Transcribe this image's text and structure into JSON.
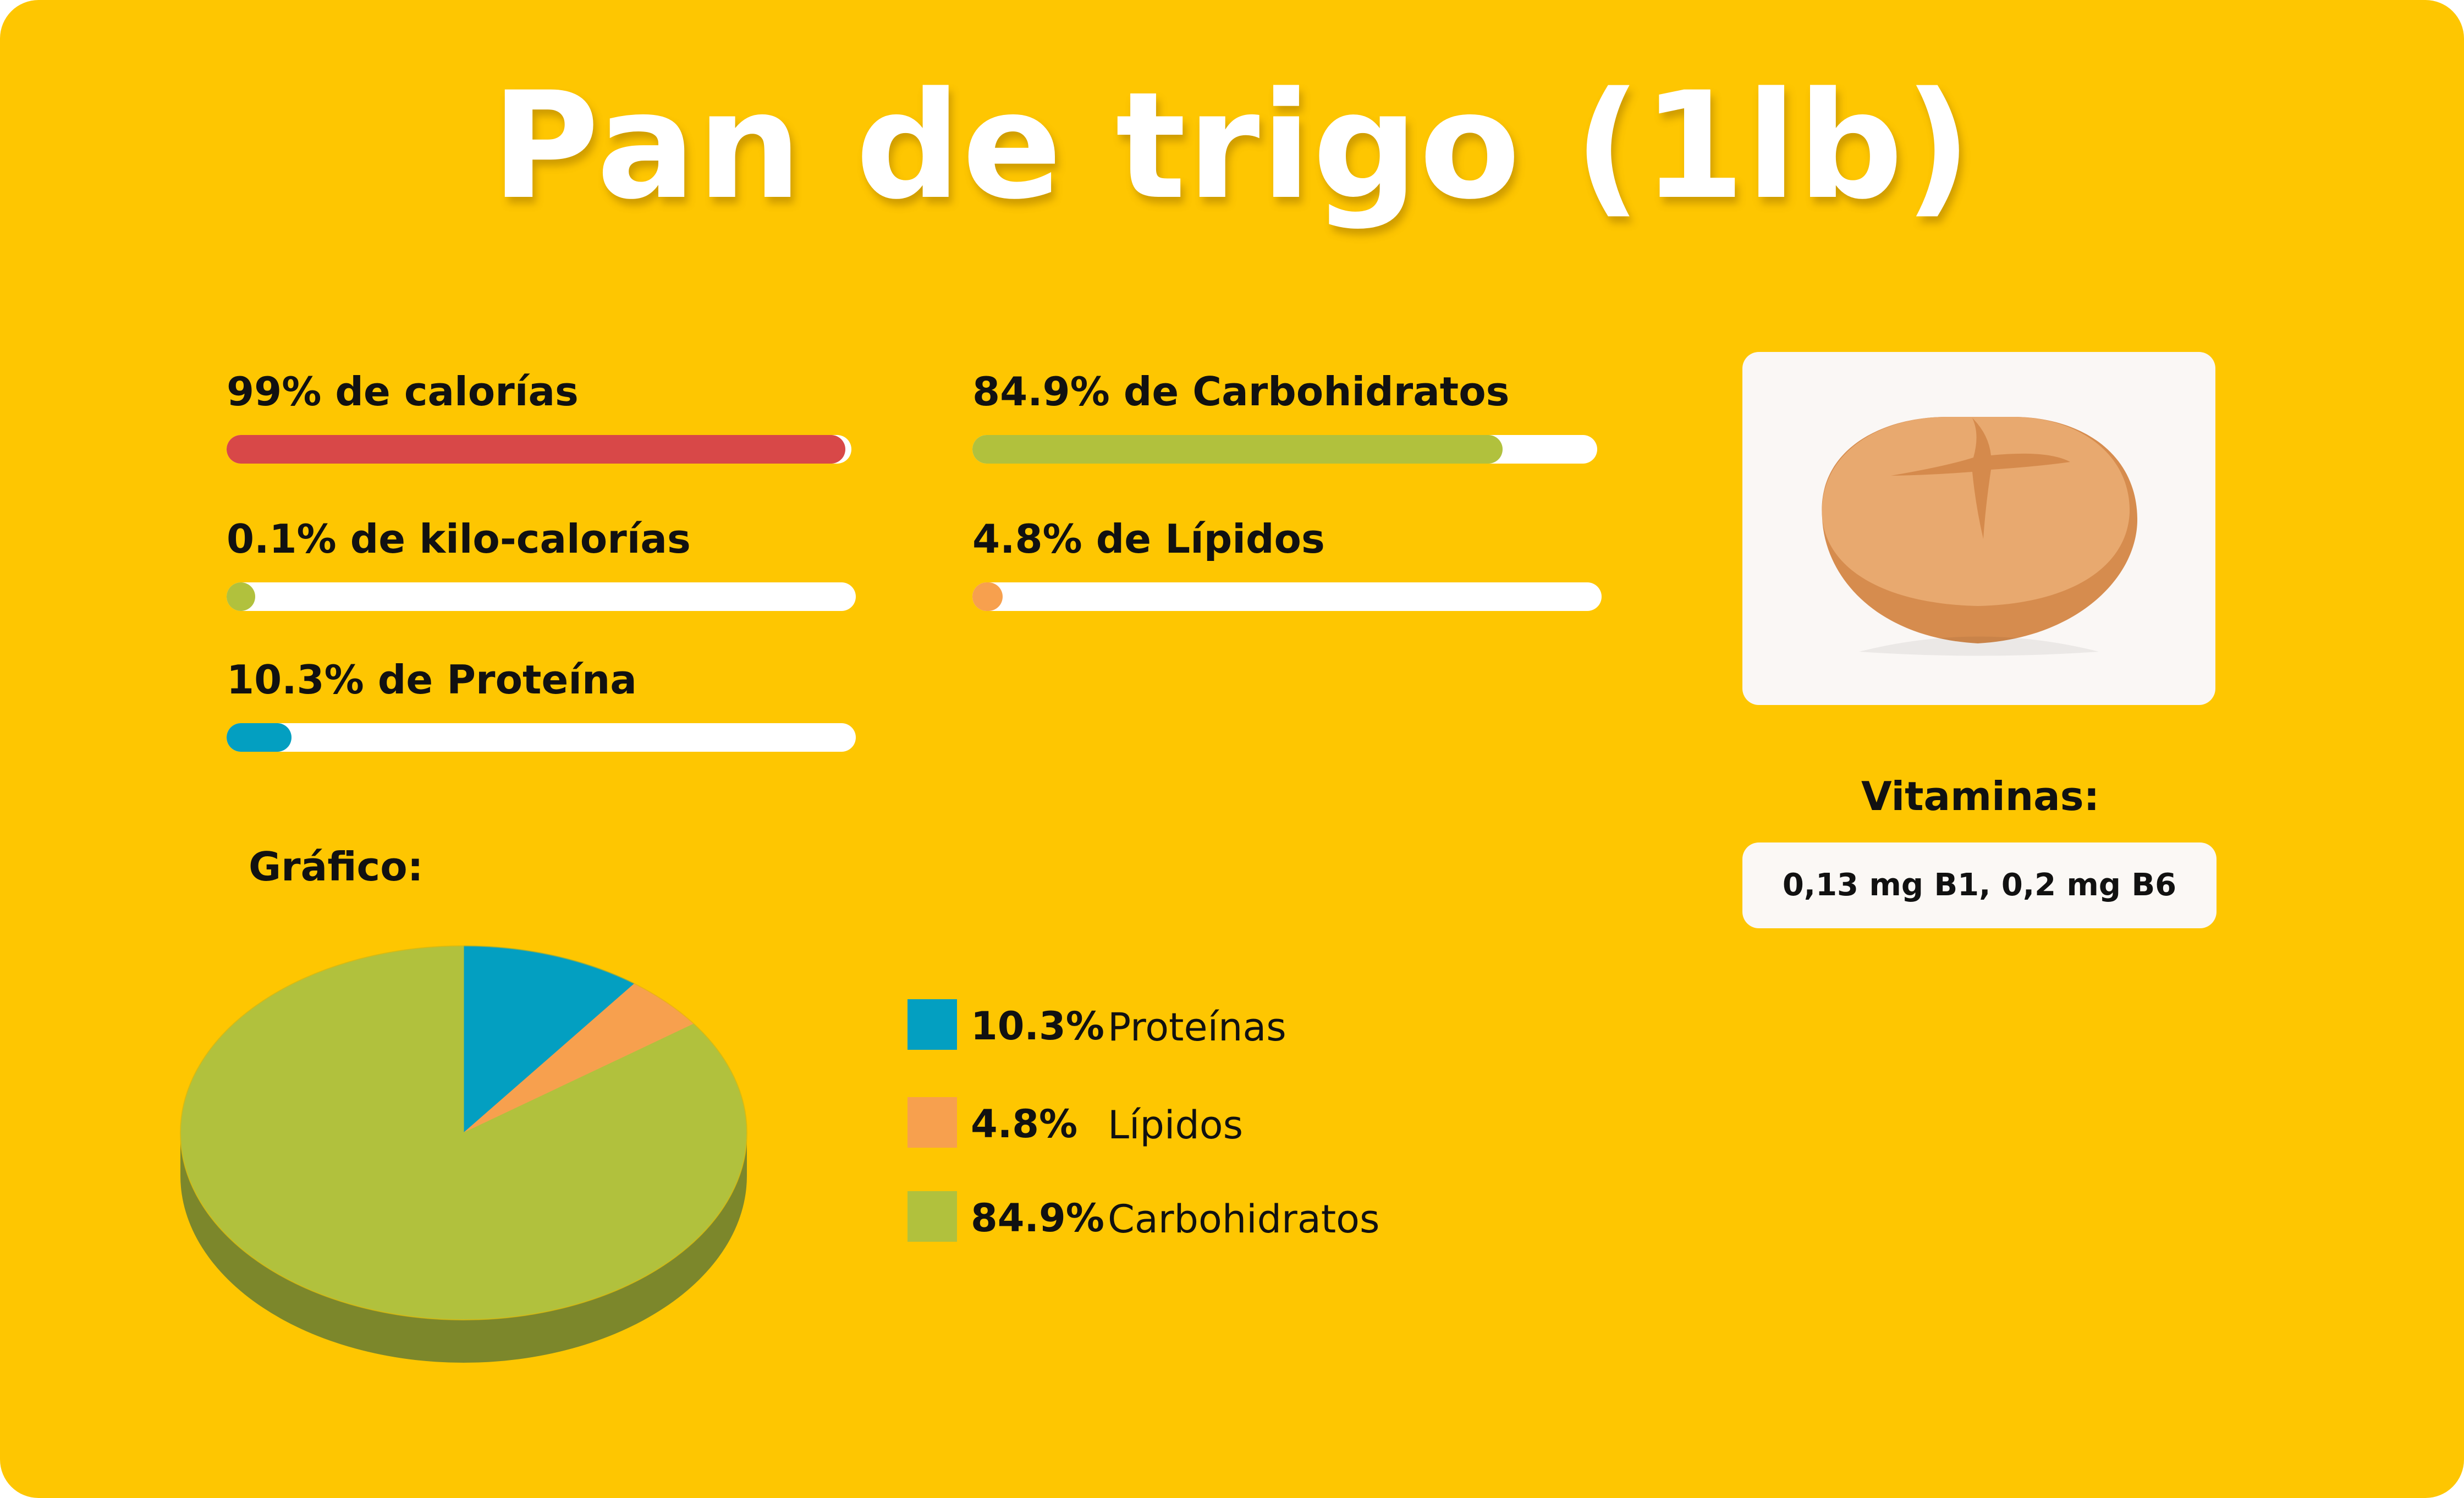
{
  "title": "Pan de trigo (1lb)",
  "metrics": [
    {
      "label": "99% de calorías",
      "percent": 99,
      "color": "#D84848"
    },
    {
      "label": "84.9% de Carbohidratos",
      "percent": 84.9,
      "color": "#B1C13D"
    },
    {
      "label": "0.1% de kilo-calorías",
      "percent": 0.1,
      "color": "#B1C13D"
    },
    {
      "label": "4.8% de Lípidos",
      "percent": 4.8,
      "color": "#F7A04E"
    },
    {
      "label": "10.3% de Proteína",
      "percent": 10.3,
      "color": "#039FC1"
    }
  ],
  "chart_section_label": "Gráfico:",
  "vitamins": {
    "label": "Vitaminas:",
    "value": "0,13 mg B1, 0,2 mg B6"
  },
  "legend": [
    {
      "pct": "10.3%",
      "name": "Proteínas"
    },
    {
      "pct": "4.8%",
      "name": "Lípidos"
    },
    {
      "pct": "84.9%",
      "name": "Carbohidratos"
    }
  ],
  "colors": {
    "background": "#FEC601",
    "proteins": "#039FC1",
    "lipids": "#F7A04E",
    "carbs": "#B1C13D",
    "calories": "#D84848"
  },
  "image": {
    "icon": "bread-loaf-icon"
  },
  "chart_data": {
    "type": "pie",
    "title": "",
    "categories": [
      "Proteínas",
      "Lípidos",
      "Carbohidratos"
    ],
    "values": [
      10.3,
      4.8,
      84.9
    ],
    "colors": [
      "#039FC1",
      "#F7A04E",
      "#B1C13D"
    ],
    "style": "3d",
    "legend": "right"
  }
}
